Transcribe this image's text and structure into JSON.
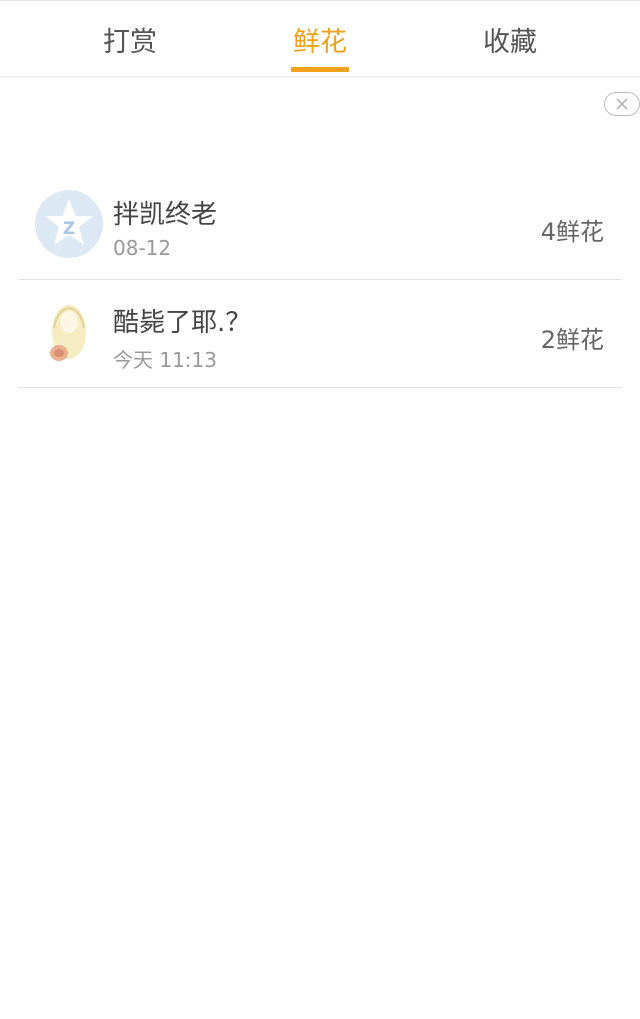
{
  "tabs": [
    {
      "label": "打赏",
      "active": false
    },
    {
      "label": "鲜花",
      "active": true
    },
    {
      "label": "收藏",
      "active": false
    }
  ],
  "accent_color": "#f0a21c",
  "close_icon": "close-icon",
  "records": [
    {
      "name": "拌凯终老",
      "time": "08-12",
      "amount": "4鲜花",
      "avatar": "qq-star-avatar"
    },
    {
      "name": "酷毙了耶.？",
      "time": "今天 11:13",
      "amount": "2鲜花",
      "avatar": "anime-girl-avatar"
    }
  ]
}
